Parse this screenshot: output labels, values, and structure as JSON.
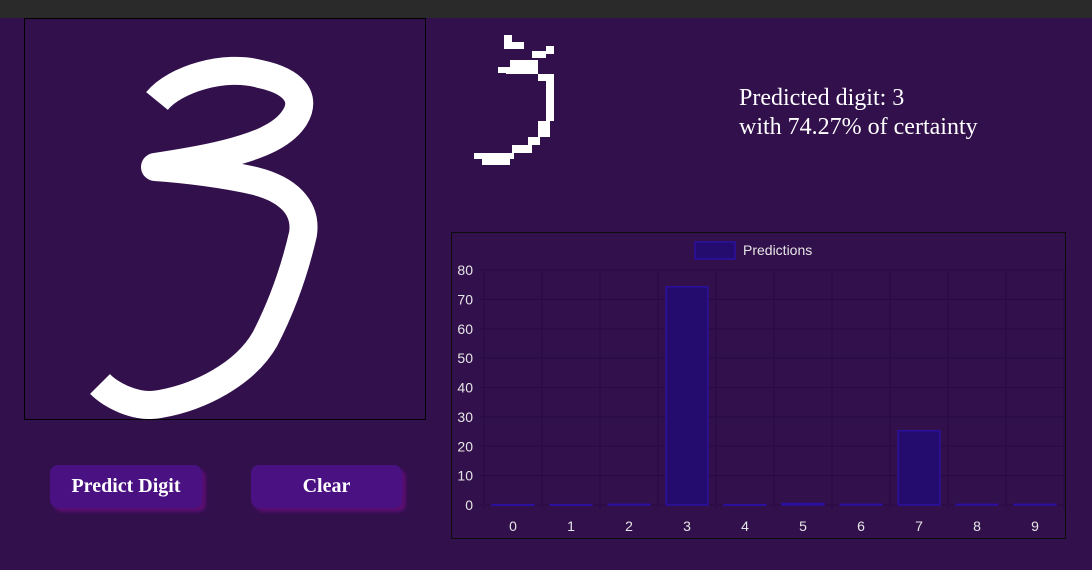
{
  "canvas": {
    "stroke_color": "#ffffff",
    "background": "#32104c"
  },
  "buttons": {
    "predict_label": "Predict Digit",
    "clear_label": "Clear"
  },
  "result": {
    "prediction_text": "Predicted digit: 3",
    "certainty_text": "with 74.27% of certainty"
  },
  "colors": {
    "background": "#32104c",
    "button": "#4a1183",
    "bar_fill": "#240c6e",
    "bar_border": "#2b10a0"
  },
  "chart_data": {
    "type": "bar",
    "categories": [
      "0",
      "1",
      "2",
      "3",
      "4",
      "5",
      "6",
      "7",
      "8",
      "9"
    ],
    "series": [
      {
        "name": "Predictions",
        "values": [
          0.1,
          0.1,
          0.2,
          74.27,
          0.1,
          0.5,
          0.2,
          25.3,
          0.2,
          0.2
        ]
      }
    ],
    "y_ticks": [
      "0",
      "10",
      "20",
      "30",
      "40",
      "50",
      "60",
      "70",
      "80"
    ],
    "ylim": [
      0,
      80
    ],
    "grid": true,
    "legend": "top-center"
  }
}
